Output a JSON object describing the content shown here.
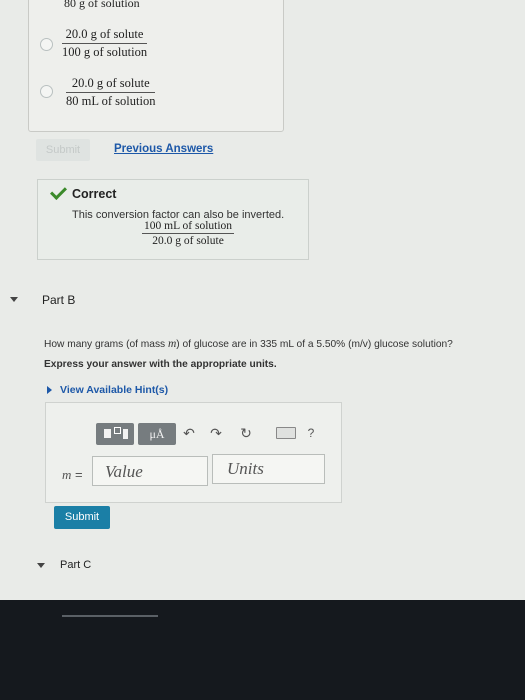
{
  "part_a": {
    "choice_fragment": "80 g of solution",
    "choices": [
      {
        "numerator": "20.0 g of solute",
        "denominator": "100 g of solution"
      },
      {
        "numerator": "20.0 g of solute",
        "denominator": "80 mL of solution"
      }
    ],
    "submit_label": "Submit",
    "previous_answers_label": "Previous Answers",
    "feedback": {
      "title": "Correct",
      "message": "This conversion factor can also be inverted.",
      "numerator": "100 mL of solution",
      "denominator": "20.0 g of solute"
    }
  },
  "part_b": {
    "title": "Part B",
    "question_prefix": "How many grams (of mass ",
    "question_var": "m",
    "question_suffix": ") of glucose are in 335 mL of a 5.50% (m/v) glucose solution?",
    "instruction": "Express your answer with the appropriate units.",
    "hint_label": "View Available Hint(s)",
    "toolbar": {
      "units_label": "μÅ",
      "undo_glyph": "↶",
      "redo_glyph": "↷",
      "reset_glyph": "↻",
      "help_label": "?"
    },
    "input_label_var": "m",
    "input_label_eq": " =",
    "value_placeholder": "Value",
    "units_placeholder": "Units",
    "submit_label": "Submit"
  },
  "part_c": {
    "title": "Part C"
  },
  "colors": {
    "link": "#1d58a8",
    "submit": "#1b7fa6",
    "correct": "#3b8a2a"
  }
}
